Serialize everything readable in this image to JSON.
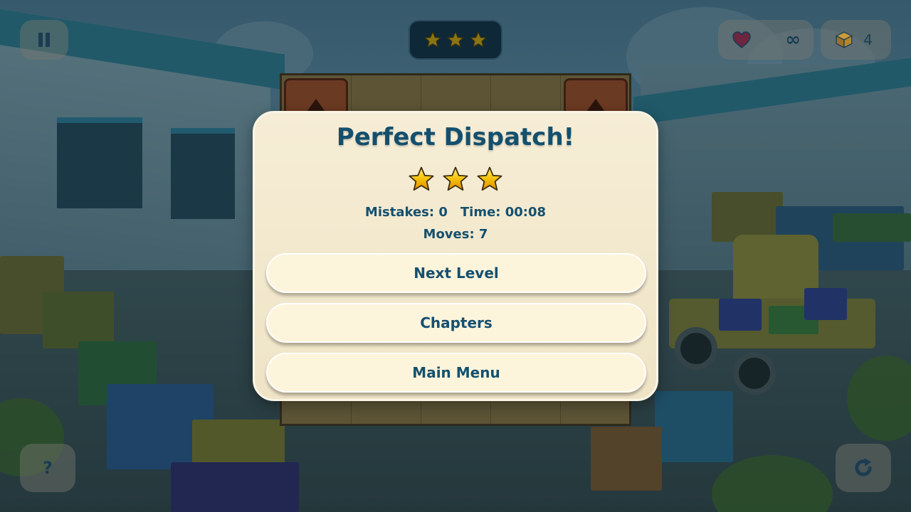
{
  "hud": {
    "lives_value": "∞",
    "boxes_count": "4",
    "tray_stars_earned": 3,
    "tray_stars_total": 3
  },
  "modal": {
    "title": "Perfect Dispatch!",
    "stars_earned": 3,
    "stars_total": 3,
    "mistakes": "Mistakes: 0",
    "time": "Time: 00:08",
    "moves": "Moves: 7",
    "buttons": {
      "next_level": "Next Level",
      "chapters": "Chapters",
      "main_menu": "Main Menu"
    }
  },
  "help": {
    "label": "?"
  },
  "colors": {
    "title_text": "#14506e",
    "star_gold": "#f5c20a",
    "panel_bg": "#f3e9cf",
    "button_bg": "#fdf4dc"
  }
}
